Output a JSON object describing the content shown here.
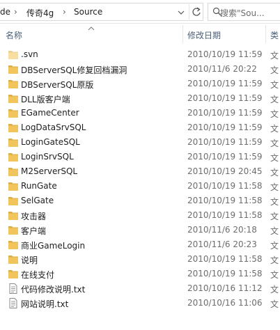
{
  "address": {
    "crumbs": [
      "de",
      "传奇4g",
      "Source"
    ],
    "separator": "›"
  },
  "search": {
    "placeholder": "搜索\"Sou..."
  },
  "columns": {
    "name": "名称",
    "date": "修改日期",
    "type": "类"
  },
  "files": [
    {
      "name": ".svn",
      "date": "2010/10/19 11:59",
      "type": "文",
      "icon": "folder-light-icon"
    },
    {
      "name": "DBServerSQL修复回档漏洞",
      "date": "2010/11/6 20:22",
      "type": "文",
      "icon": "folder-icon"
    },
    {
      "name": "DBServerSQL原版",
      "date": "2010/10/19 11:59",
      "type": "文",
      "icon": "folder-icon"
    },
    {
      "name": "DLL版客户端",
      "date": "2010/10/19 11:59",
      "type": "文",
      "icon": "folder-icon"
    },
    {
      "name": "EGameCenter",
      "date": "2010/10/19 11:59",
      "type": "文",
      "icon": "folder-icon"
    },
    {
      "name": "LogDataSrvSQL",
      "date": "2010/10/19 11:59",
      "type": "文",
      "icon": "folder-icon"
    },
    {
      "name": "LoginGateSQL",
      "date": "2010/10/19 11:59",
      "type": "文",
      "icon": "folder-icon"
    },
    {
      "name": "LoginSrvSQL",
      "date": "2010/10/19 11:59",
      "type": "文",
      "icon": "folder-icon"
    },
    {
      "name": "M2ServerSQL",
      "date": "2010/10/19 20:45",
      "type": "文",
      "icon": "folder-icon"
    },
    {
      "name": "RunGate",
      "date": "2010/10/19 11:58",
      "type": "文",
      "icon": "folder-icon"
    },
    {
      "name": "SelGate",
      "date": "2010/10/19 11:58",
      "type": "文",
      "icon": "folder-icon"
    },
    {
      "name": "攻击器",
      "date": "2010/10/19 11:58",
      "type": "文",
      "icon": "folder-icon"
    },
    {
      "name": "客户端",
      "date": "2010/11/6 20:18",
      "type": "文",
      "icon": "folder-icon"
    },
    {
      "name": "商业GameLogin",
      "date": "2010/11/6 20:23",
      "type": "文",
      "icon": "folder-icon"
    },
    {
      "name": "说明",
      "date": "2010/10/19 11:58",
      "type": "文",
      "icon": "folder-icon"
    },
    {
      "name": "在线支付",
      "date": "2010/10/19 11:58",
      "type": "文",
      "icon": "folder-icon"
    },
    {
      "name": "代码修改说明.txt",
      "date": "2010/10/16 11:12",
      "type": "文",
      "icon": "text-file-icon"
    },
    {
      "name": "网站说明.txt",
      "date": "2010/10/16 11:06",
      "type": "文",
      "icon": "text-file-icon"
    }
  ],
  "colors": {
    "folder": "#f2c55c",
    "folder_light": "#f8dfa0",
    "header_text": "#4c607a",
    "date_text": "#6d6d6d"
  }
}
